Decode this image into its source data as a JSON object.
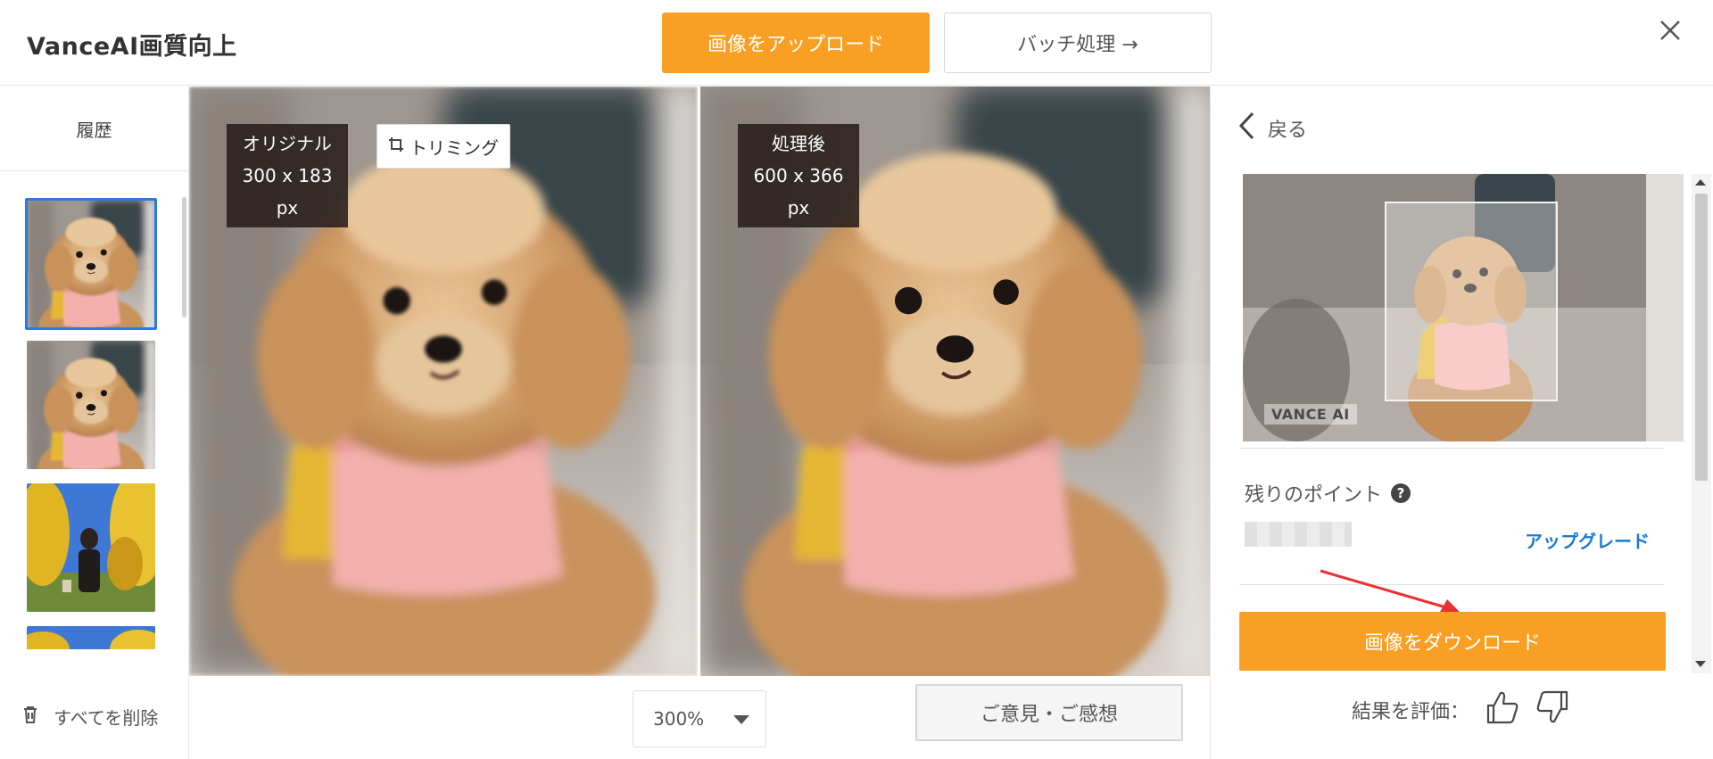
{
  "header": {
    "app_title": "VanceAI画質向上",
    "upload_label": "画像をアップロード",
    "batch_label": "バッチ処理 →"
  },
  "sidebar": {
    "history_label": "履歴",
    "delete_all_label": "すべてを削除"
  },
  "compare": {
    "original_title": "オリジナル",
    "original_size": "300 x 183 px",
    "processed_title": "処理後",
    "processed_size": "600 x 366 px",
    "trim_label": "トリミング"
  },
  "controls": {
    "zoom_value": "300%",
    "feedback_label": "ご意見・ご感想"
  },
  "rpanel": {
    "back_label": "戻る",
    "watermark": "VANCE AI",
    "points_label": "残りのポイント",
    "help_glyph": "?",
    "upgrade_label": "アップグレード",
    "download_label": "画像をダウンロード",
    "rate_label": "結果を評価："
  },
  "colors": {
    "accent": "#f9a024",
    "link": "#1a7ad4",
    "selected_border": "#2a7ae2",
    "annotation_arrow": "#e8322f"
  }
}
